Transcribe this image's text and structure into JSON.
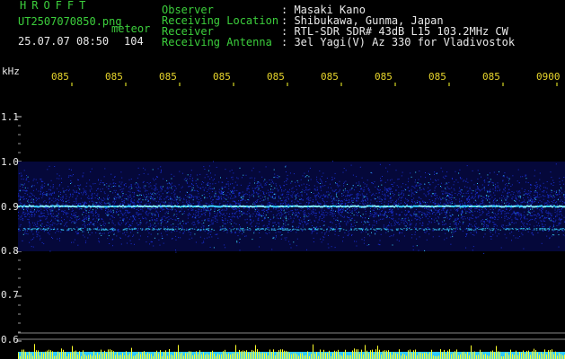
{
  "app": {
    "title": "HROFFT",
    "file_name": "UT2507070850.png",
    "mode_label": "meteor",
    "date_time": "25.07.07 08:50",
    "count": "104"
  },
  "header": {
    "fields": [
      {
        "label": "Observer",
        "value": ": Masaki Kano"
      },
      {
        "label": "Receiving Location",
        "value": ": Shibukawa, Gunma, Japan"
      },
      {
        "label": "Receiver",
        "value": ": RTL-SDR SDR# 43dB L15 103.2MHz CW"
      },
      {
        "label": "Receiving Antenna",
        "value": ": 3el Yagi(V) Az 330 for Vladivostok"
      }
    ]
  },
  "chart_data": {
    "type": "heatmap",
    "ylabel": "kHz",
    "y_ticks": [
      "1.1",
      "1.0",
      "0.9",
      "0.8",
      "0.7",
      "0.6"
    ],
    "ylim": [
      0.6,
      1.1
    ],
    "x_ticks": [
      "085",
      "085",
      "085",
      "085",
      "085",
      "085",
      "085",
      "085",
      "085",
      "0900"
    ],
    "signal_band_khz": [
      0.8,
      1.0
    ],
    "carrier_khz": 0.9,
    "colors": {
      "noise": "#1a2fd0",
      "signal": "#3bd6ff",
      "carrier": "#7ff0ff",
      "footer_bar": "#2fc9ff",
      "spikes": "#ffff2a"
    }
  }
}
